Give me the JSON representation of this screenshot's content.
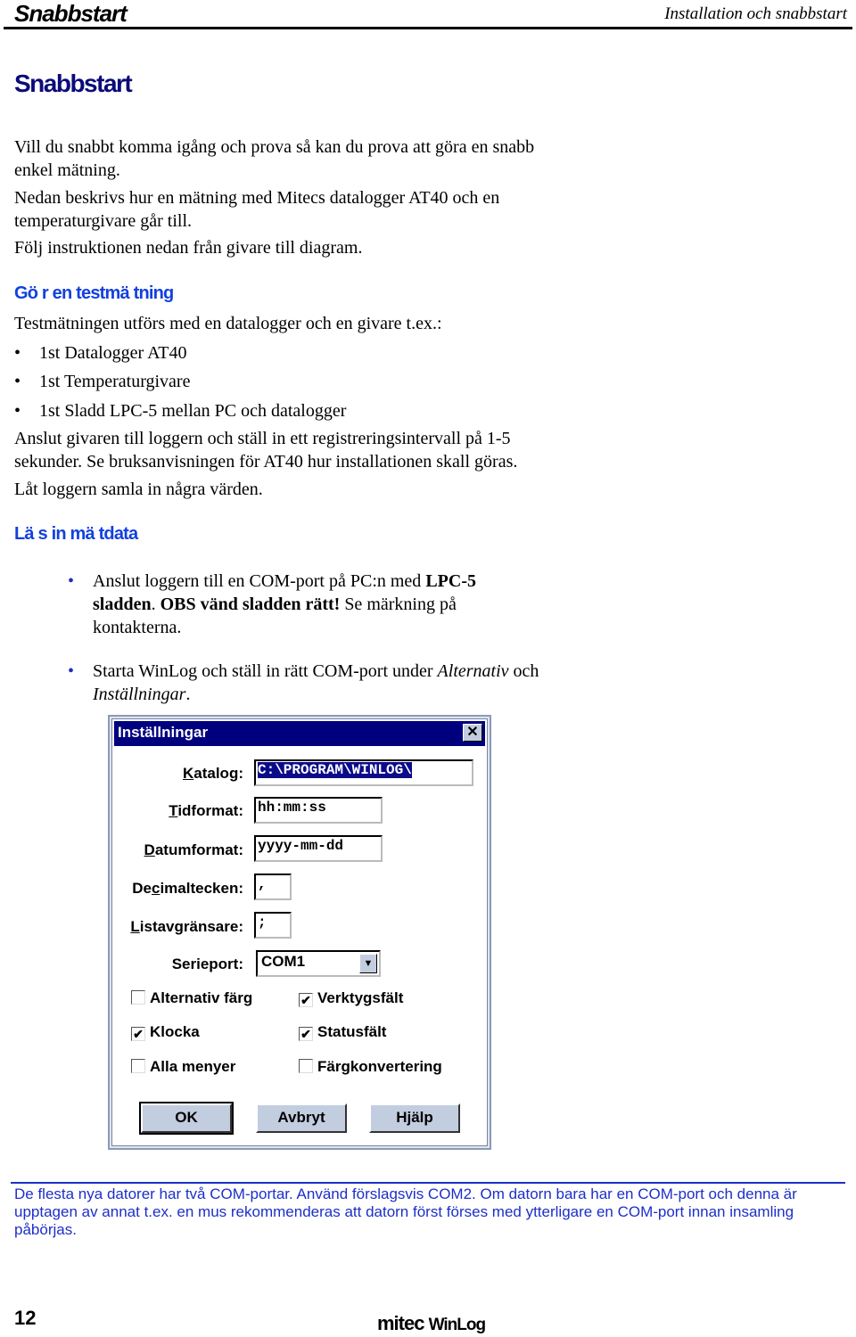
{
  "header": {
    "section": "Snabbstart",
    "chapter": "Installation och snabbstart"
  },
  "title": "Snabbstart",
  "intro": [
    "Vill du snabbt komma igång och prova så kan du prova att göra en snabb enkel mätning.",
    "Nedan beskrivs hur en mätning med Mitecs datalogger AT40 och en temperaturgivare går till.",
    "Följ instruktionen nedan från givare till diagram."
  ],
  "section1": {
    "heading": "Gö r en testmä tning",
    "lead": "Testmätningen utförs med en datalogger och en givare t.ex.:",
    "items": [
      "1st Datalogger AT40",
      "1st Temperaturgivare",
      "1st Sladd LPC-5 mellan PC och datalogger"
    ],
    "p1": "Anslut givaren till loggern och ställ in ett registreringsintervall på 1-5 sekunder. Se bruksanvisningen för AT40 hur installationen skall göras.",
    "p2": "Låt loggern samla in några värden."
  },
  "section2": {
    "heading": "Lä s in mä tdata",
    "b1": {
      "t1": "Anslut loggern till en COM-port på PC:n med ",
      "t2": "LPC-5 sladden",
      "t3": ". ",
      "t4": "OBS vänd sladden rätt!",
      "t5": " Se märkning på kontakterna."
    },
    "b2": {
      "t1": "Starta WinLog och ställ in rätt COM-port under ",
      "t2": "Alternativ",
      "t3": " och ",
      "t4": "Inställningar",
      "t5": "."
    }
  },
  "dialog": {
    "title": "Inställningar",
    "close": "✕",
    "fields": [
      {
        "key": "K",
        "label": "atalog:",
        "value": "C:\\PROGRAM\\WINLOG\\"
      },
      {
        "key": "T",
        "label": "idformat:",
        "value": "hh:mm:ss"
      },
      {
        "key": "D",
        "label": "atumformat:",
        "value": "yyyy-mm-dd"
      },
      {
        "pre": "De",
        "key": "c",
        "label": "imaltecken:",
        "value": ","
      },
      {
        "key": "L",
        "label": "istavgränsare:",
        "value": ";"
      }
    ],
    "serieport": {
      "label": "Serieport:",
      "value": "COM1"
    },
    "checks": [
      {
        "label": "Alternativ färg",
        "checked": false
      },
      {
        "label": "Verktygsfält",
        "checked": true
      },
      {
        "label": "Klocka",
        "checked": true
      },
      {
        "label": "Statusfält",
        "checked": true
      },
      {
        "label": "Alla menyer",
        "checked": false
      },
      {
        "label": "Färgkonvertering",
        "checked": false
      }
    ],
    "buttons": [
      "OK",
      "Avbryt",
      "Hjälp"
    ]
  },
  "note": "De flesta nya datorer har två COM-portar. Använd förslagsvis COM2. Om datorn bara har en COM-port och denna är upptagen av annat t.ex. en mus rekommenderas att datorn först förses med ytterligare en COM-port innan insamling påbörjas.",
  "footer": {
    "page": "12",
    "brand1": "mitec",
    "brand2": "WinLog"
  },
  "colors": {
    "heading": "#0b0b7a",
    "subheading": "#1240e0",
    "note": "#1c2fc8",
    "titlebar": "#00007e"
  }
}
